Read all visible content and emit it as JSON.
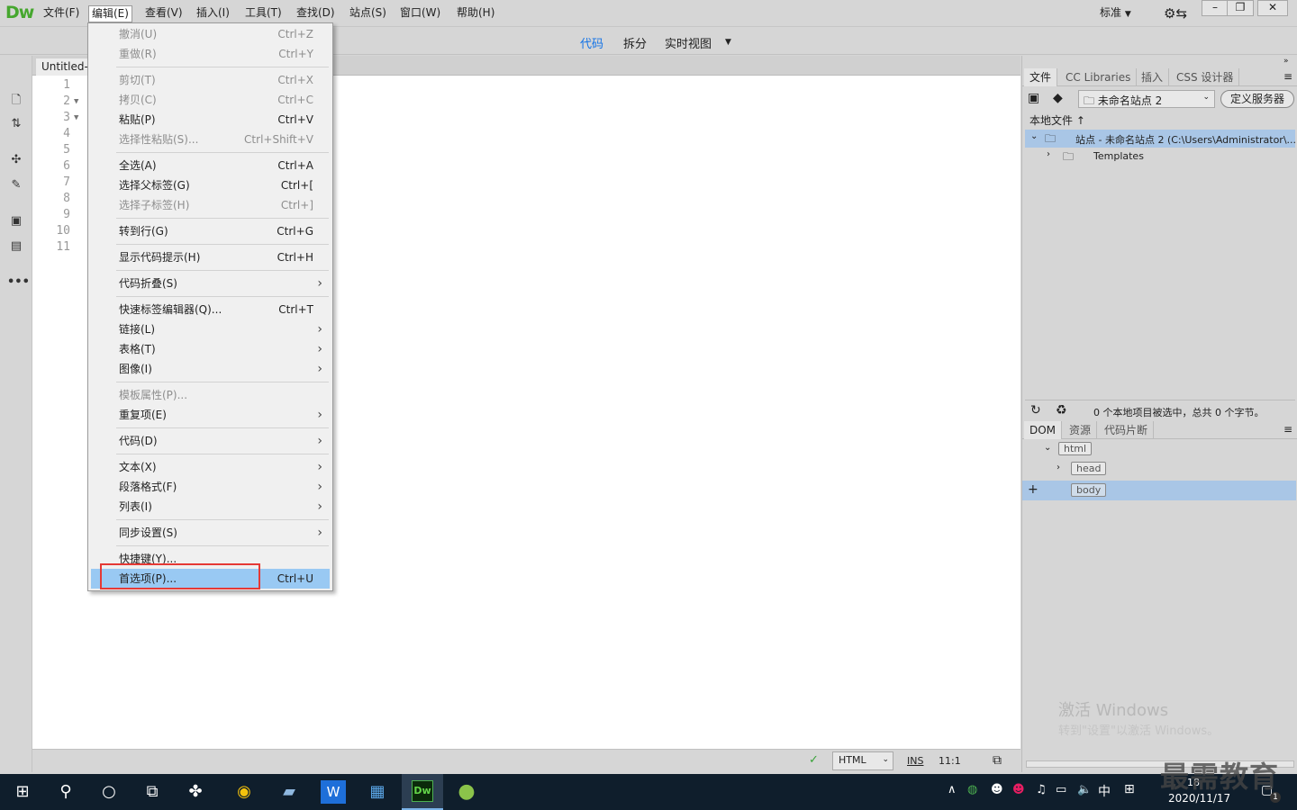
{
  "app": {
    "logo": "Dw",
    "workspace": "标准"
  },
  "menubar": [
    "文件(F)",
    "编辑(E)",
    "查看(V)",
    "插入(I)",
    "工具(T)",
    "查找(D)",
    "站点(S)",
    "窗口(W)",
    "帮助(H)"
  ],
  "viewbar": {
    "code": "代码",
    "split": "拆分",
    "live": "实时视图"
  },
  "document": {
    "tab": "Untitled-",
    "lines": [
      "1",
      "2",
      "3",
      "4",
      "5",
      "6",
      "7",
      "8",
      "9",
      "10",
      "11"
    ]
  },
  "edit_menu": {
    "undo": {
      "label": "撤消(U)",
      "shortcut": "Ctrl+Z"
    },
    "redo": {
      "label": "重做(R)",
      "shortcut": "Ctrl+Y"
    },
    "cut": {
      "label": "剪切(T)",
      "shortcut": "Ctrl+X"
    },
    "copy": {
      "label": "拷贝(C)",
      "shortcut": "Ctrl+C"
    },
    "paste": {
      "label": "粘贴(P)",
      "shortcut": "Ctrl+V"
    },
    "paste_special": {
      "label": "选择性粘贴(S)...",
      "shortcut": "Ctrl+Shift+V"
    },
    "select_all": {
      "label": "全选(A)",
      "shortcut": "Ctrl+A"
    },
    "select_parent": {
      "label": "选择父标签(G)",
      "shortcut": "Ctrl+["
    },
    "select_child": {
      "label": "选择子标签(H)",
      "shortcut": "Ctrl+]"
    },
    "goto_line": {
      "label": "转到行(G)",
      "shortcut": "Ctrl+G"
    },
    "code_hints": {
      "label": "显示代码提示(H)",
      "shortcut": "Ctrl+H"
    },
    "code_collapse": {
      "label": "代码折叠(S)"
    },
    "quick_tag": {
      "label": "快速标签编辑器(Q)...",
      "shortcut": "Ctrl+T"
    },
    "link": {
      "label": "链接(L)"
    },
    "table": {
      "label": "表格(T)"
    },
    "image": {
      "label": "图像(I)"
    },
    "template_props": {
      "label": "模板属性(P)..."
    },
    "repeating": {
      "label": "重复项(E)"
    },
    "code": {
      "label": "代码(D)"
    },
    "text": {
      "label": "文本(X)"
    },
    "paragraph": {
      "label": "段落格式(F)"
    },
    "list": {
      "label": "列表(I)"
    },
    "sync": {
      "label": "同步设置(S)"
    },
    "keyboard": {
      "label": "快捷键(Y)..."
    },
    "preferences": {
      "label": "首选项(P)...",
      "shortcut": "Ctrl+U"
    }
  },
  "files_panel": {
    "tabs": [
      "文件",
      "CC Libraries",
      "插入",
      "CSS 设计器"
    ],
    "site_select": "未命名站点 2",
    "define_server": "定义服务器",
    "local_files": "本地文件",
    "site_root": "站点 - 未命名站点 2 (C:\\Users\\Administrator\\...",
    "templates": "Templates",
    "status": "0 个本地项目被选中，总共 0 个字节。"
  },
  "dom_panel": {
    "tabs": [
      "DOM",
      "资源",
      "代码片断"
    ],
    "nodes": [
      "html",
      "head",
      "body"
    ]
  },
  "status_bar": {
    "language": "HTML",
    "mode": "INS",
    "position": "11:1"
  },
  "activation": {
    "line1": "激活 Windows",
    "line2": "转到\"设置\"以激活 Windows。"
  },
  "taskbar": {
    "ime": "中",
    "time": "18",
    "date": "2020/11/17",
    "notifications": "1"
  },
  "watermark": "最需教育",
  "colors": {
    "menu_highlight": "#99c9f3",
    "highlight_box": "#e53935",
    "dw_green": "#46a72f"
  }
}
